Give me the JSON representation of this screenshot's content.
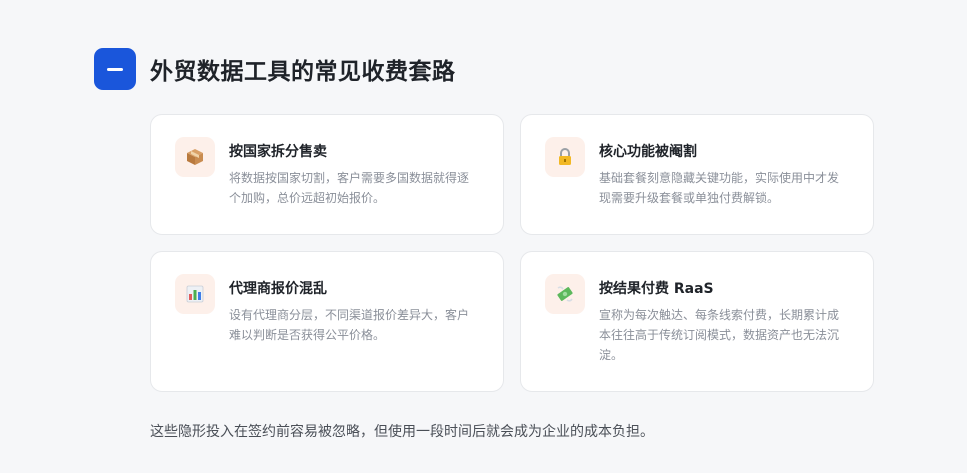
{
  "header": {
    "title": "外贸数据工具的常见收费套路",
    "badge_icon": "minus-icon"
  },
  "cards": [
    {
      "icon": "package-icon",
      "title": "按国家拆分售卖",
      "desc": "将数据按国家切割，客户需要多国数据就得逐个加购，总价远超初始报价。"
    },
    {
      "icon": "lock-icon",
      "title": "核心功能被阉割",
      "desc": "基础套餐刻意隐藏关键功能，实际使用中才发现需要升级套餐或单独付费解锁。"
    },
    {
      "icon": "bar-chart-icon",
      "title": "代理商报价混乱",
      "desc": "设有代理商分层，不同渠道报价差异大，客户难以判断是否获得公平价格。"
    },
    {
      "icon": "money-wings-icon",
      "title": "按结果付费 RaaS",
      "desc": "宣称为每次触达、每条线索付费，长期累计成本往往高于传统订阅模式，数据资产也无法沉淀。"
    }
  ],
  "footer": {
    "text": "这些隐形投入在签约前容易被忽略，但使用一段时间后就会成为企业的成本负担。"
  },
  "colors": {
    "accent": "#1a56db",
    "icon_bg": "#fdf0ea"
  }
}
